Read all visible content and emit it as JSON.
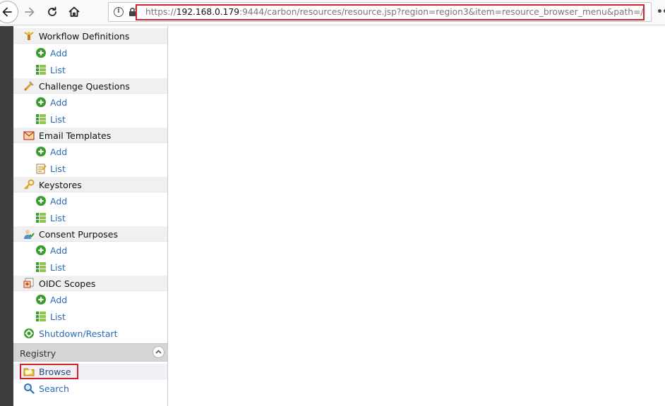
{
  "browser": {
    "url_scheme": "https://",
    "url_host": "192.168.0.179",
    "url_rest": ":9444/carbon/resources/resource.jsp?region=region3&item=resource_browser_menu&path=/",
    "info_symbol": "i",
    "more_symbol": "••"
  },
  "sidebar": {
    "sections": [
      {
        "title": "Workflow Definitions",
        "icon": "workflow-icon",
        "items": [
          {
            "label": "Add",
            "icon": "add-icon"
          },
          {
            "label": "List",
            "icon": "list-icon"
          }
        ]
      },
      {
        "title": "Challenge Questions",
        "icon": "challenge-icon",
        "items": [
          {
            "label": "Add",
            "icon": "add-icon"
          },
          {
            "label": "List",
            "icon": "list-icon"
          }
        ]
      },
      {
        "title": "Email Templates",
        "icon": "email-icon",
        "items": [
          {
            "label": "Add",
            "icon": "add-icon"
          },
          {
            "label": "List",
            "icon": "notepad-list-icon"
          }
        ]
      },
      {
        "title": "Keystores",
        "icon": "key-icon",
        "items": [
          {
            "label": "Add",
            "icon": "add-icon"
          },
          {
            "label": "List",
            "icon": "list-icon"
          }
        ]
      },
      {
        "title": "Consent Purposes",
        "icon": "consent-icon",
        "items": [
          {
            "label": "Add",
            "icon": "add-icon"
          },
          {
            "label": "List",
            "icon": "list-icon"
          }
        ]
      },
      {
        "title": "OIDC Scopes",
        "icon": "oidc-icon",
        "items": [
          {
            "label": "Add",
            "icon": "add-icon"
          },
          {
            "label": "List",
            "icon": "list-icon"
          }
        ]
      }
    ],
    "shutdown_label": "Shutdown/Restart",
    "registry": {
      "title": "Registry",
      "browse_label": "Browse",
      "search_label": "Search"
    }
  },
  "colors": {
    "link": "#2a6bb5",
    "highlight_border": "#d3232a",
    "dark_strip": "#3d3d3d",
    "section_bg": "#f0f0f0"
  }
}
